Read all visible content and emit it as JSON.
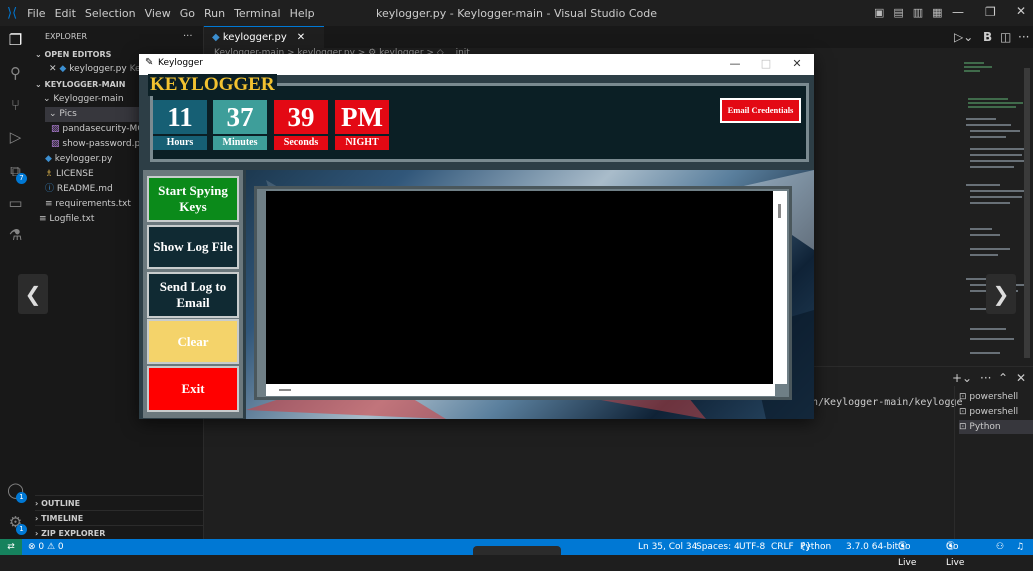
{
  "vscode": {
    "menu": [
      "File",
      "Edit",
      "Selection",
      "View",
      "Go",
      "Run",
      "Terminal",
      "Help"
    ],
    "window_title": "keylogger.py - Keylogger-main - Visual Studio Code",
    "explorer_title": "EXPLORER",
    "explorer_more": "···",
    "open_editors": {
      "header": "OPEN EDITORS",
      "item": "keylogger.py",
      "item_extra": "Key"
    },
    "folder": {
      "header": "KEYLOGGER-MAIN",
      "root": "Keylogger-main",
      "pics": "Pics",
      "files": [
        "pandasecurity-MC-...",
        "show-password.pn..."
      ],
      "root_files": [
        "keylogger.py",
        "LICENSE",
        "README.md",
        "requirements.txt"
      ],
      "logfile": "Logfile.txt"
    },
    "bottom_sections": [
      "OUTLINE",
      "TIMELINE",
      "ZIP EXPLORER"
    ],
    "tab_label": "keylogger.py",
    "breadcrumb": "Keylogger-main > keylogger.py > ⚙ keylogger > ◇ __init__",
    "terminal_path": "n/Keylogger-main/keylogge",
    "terminals": [
      "powershell",
      "powershell",
      "Python"
    ],
    "status": {
      "errors": "⊗ 0 ⚠ 0",
      "ln_col": "Ln 35, Col 34",
      "spaces": "Spaces: 4",
      "encoding": "UTF-8",
      "eol": "CRLF",
      "language": "Python",
      "interpreter": "3.7.0 64-bit",
      "golive1": "Go Live",
      "golive2": "Go Live"
    },
    "badges": {
      "extensions": "7",
      "accounts": "1",
      "settings": "1"
    },
    "colors": {
      "accent": "#0078d4",
      "background": "#1e1e1e"
    }
  },
  "keylogger": {
    "window_title": "Keylogger",
    "heading": "KEYLOGGER",
    "hours": "11",
    "hours_label": "Hours",
    "minutes": "37",
    "minutes_label": "Minutes",
    "seconds": "39",
    "seconds_label": "Seconds",
    "ampm": "PM",
    "period_label": "NIGHT",
    "email_button": "Email Credentials",
    "buttons": {
      "start": "Start Spying Keys",
      "show": "Show Log File",
      "send": "Send Log to Email",
      "clear": "Clear",
      "exit": "Exit"
    },
    "colors": {
      "teal": "#165f74",
      "light_teal": "#3e9e9a",
      "red": "#e30914",
      "green": "#0b8a1a",
      "yellow": "#f4d36a",
      "heading": "#f2c230"
    }
  },
  "nav": {
    "prev": "❮",
    "next": "❯"
  }
}
